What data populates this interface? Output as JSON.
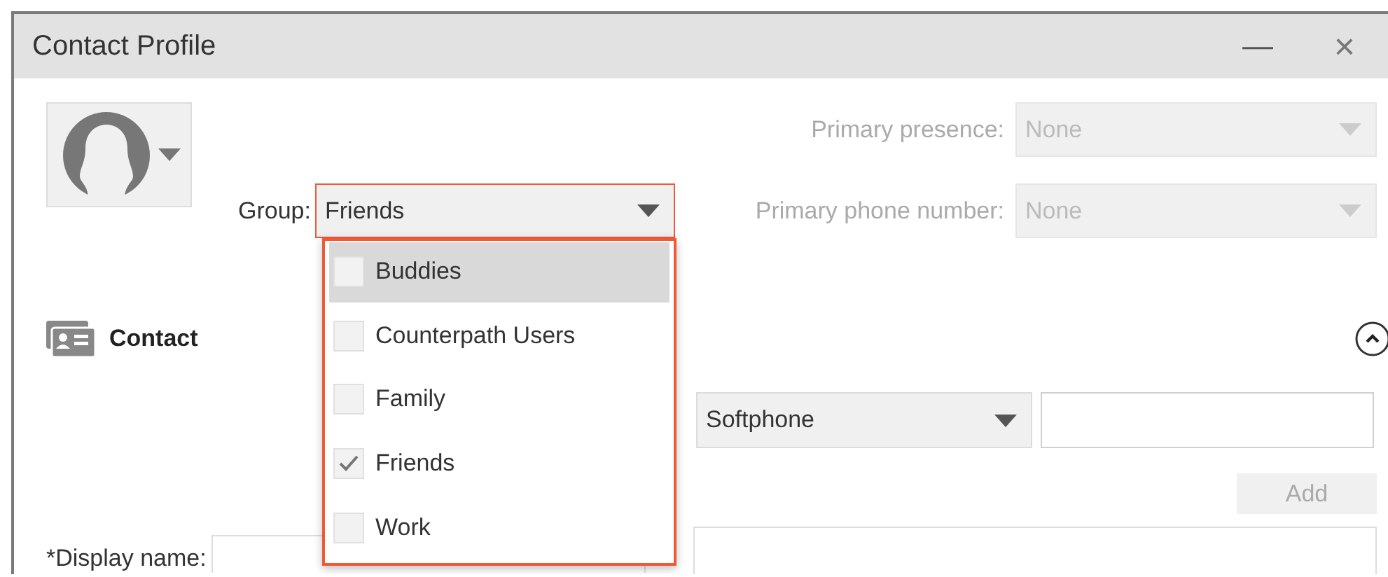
{
  "window": {
    "title": "Contact Profile",
    "controls": [
      {
        "kind": "minimize",
        "label": "—"
      },
      {
        "kind": "close",
        "label": "×"
      }
    ]
  },
  "group": {
    "label": "Group:",
    "value": "Friends",
    "open": true,
    "options": [
      {
        "label": "Buddies",
        "checked": false,
        "highlighted": true
      },
      {
        "label": "Counterpath Users",
        "checked": false,
        "highlighted": false
      },
      {
        "label": "Family",
        "checked": false,
        "highlighted": false
      },
      {
        "label": "Friends",
        "checked": true,
        "highlighted": false
      },
      {
        "label": "Work",
        "checked": false,
        "highlighted": false
      }
    ]
  },
  "primary": [
    {
      "label": "Primary presence:",
      "value": "None",
      "disabled": true
    },
    {
      "label": "Primary phone number:",
      "value": "None",
      "disabled": true
    }
  ],
  "contact_section": {
    "title": "Contact",
    "expanded": true
  },
  "address_type": {
    "value": "Softphone",
    "disabled": false
  },
  "add_button": {
    "label": "Add",
    "disabled": true
  },
  "display_name": {
    "label": "*Display name:"
  }
}
